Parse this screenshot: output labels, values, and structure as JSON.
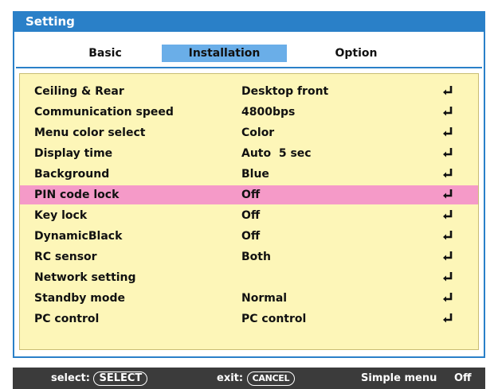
{
  "window": {
    "title": "Setting"
  },
  "tabs": [
    {
      "label": "Basic",
      "active": false
    },
    {
      "label": "Installation",
      "active": true
    },
    {
      "label": "Option",
      "active": false
    }
  ],
  "settings": [
    {
      "label": "Ceiling & Rear",
      "value": "Desktop front",
      "icon": "enter-icon"
    },
    {
      "label": "Communication speed",
      "value": "4800bps",
      "icon": "enter-icon"
    },
    {
      "label": "Menu color select",
      "value": "Color",
      "icon": "enter-icon"
    },
    {
      "label": "Display time",
      "value": "Auto  5 sec",
      "icon": "enter-icon"
    },
    {
      "label": "Background",
      "value": "Blue",
      "icon": "enter-icon"
    },
    {
      "label": "PIN code lock",
      "value": "Off",
      "icon": "enter-icon",
      "selected": true
    },
    {
      "label": "Key lock",
      "value": "Off",
      "icon": "enter-icon"
    },
    {
      "label": "DynamicBlack",
      "value": "Off",
      "icon": "enter-icon"
    },
    {
      "label": "RC sensor",
      "value": "Both",
      "icon": "enter-icon"
    },
    {
      "label": "Network setting",
      "value": "",
      "icon": "enter-icon"
    },
    {
      "label": "Standby mode",
      "value": "Normal",
      "icon": "enter-icon"
    },
    {
      "label": "PC control",
      "value": "PC control",
      "icon": "enter-icon"
    }
  ],
  "statusbar": {
    "select_label": "select:",
    "select_key": "SELECT",
    "exit_label": "exit:",
    "exit_key": "CANCEL",
    "menu_mode_label": "Simple menu",
    "menu_mode_value": "Off"
  },
  "colors": {
    "accent_blue": "#2a80c8",
    "active_tab": "#6aaee8",
    "panel_bg": "#fdf6b8",
    "selected_row": "#f59ac8",
    "statusbar_bg": "#3b3b3b"
  }
}
